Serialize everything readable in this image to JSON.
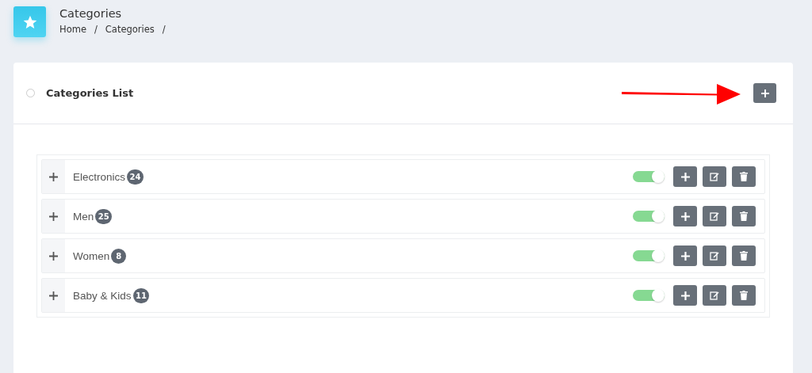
{
  "page": {
    "title": "Categories",
    "breadcrumb": [
      {
        "label": "Home",
        "separator": "/"
      },
      {
        "label": "Categories",
        "separator": "/"
      }
    ]
  },
  "card": {
    "title": "Categories List"
  },
  "categories": [
    {
      "name": "Electronics",
      "count": "24",
      "on": true
    },
    {
      "name": "Men",
      "count": "25",
      "on": true
    },
    {
      "name": "Women",
      "count": "8",
      "on": true
    },
    {
      "name": "Baby & Kids",
      "count": "11",
      "on": true
    }
  ]
}
